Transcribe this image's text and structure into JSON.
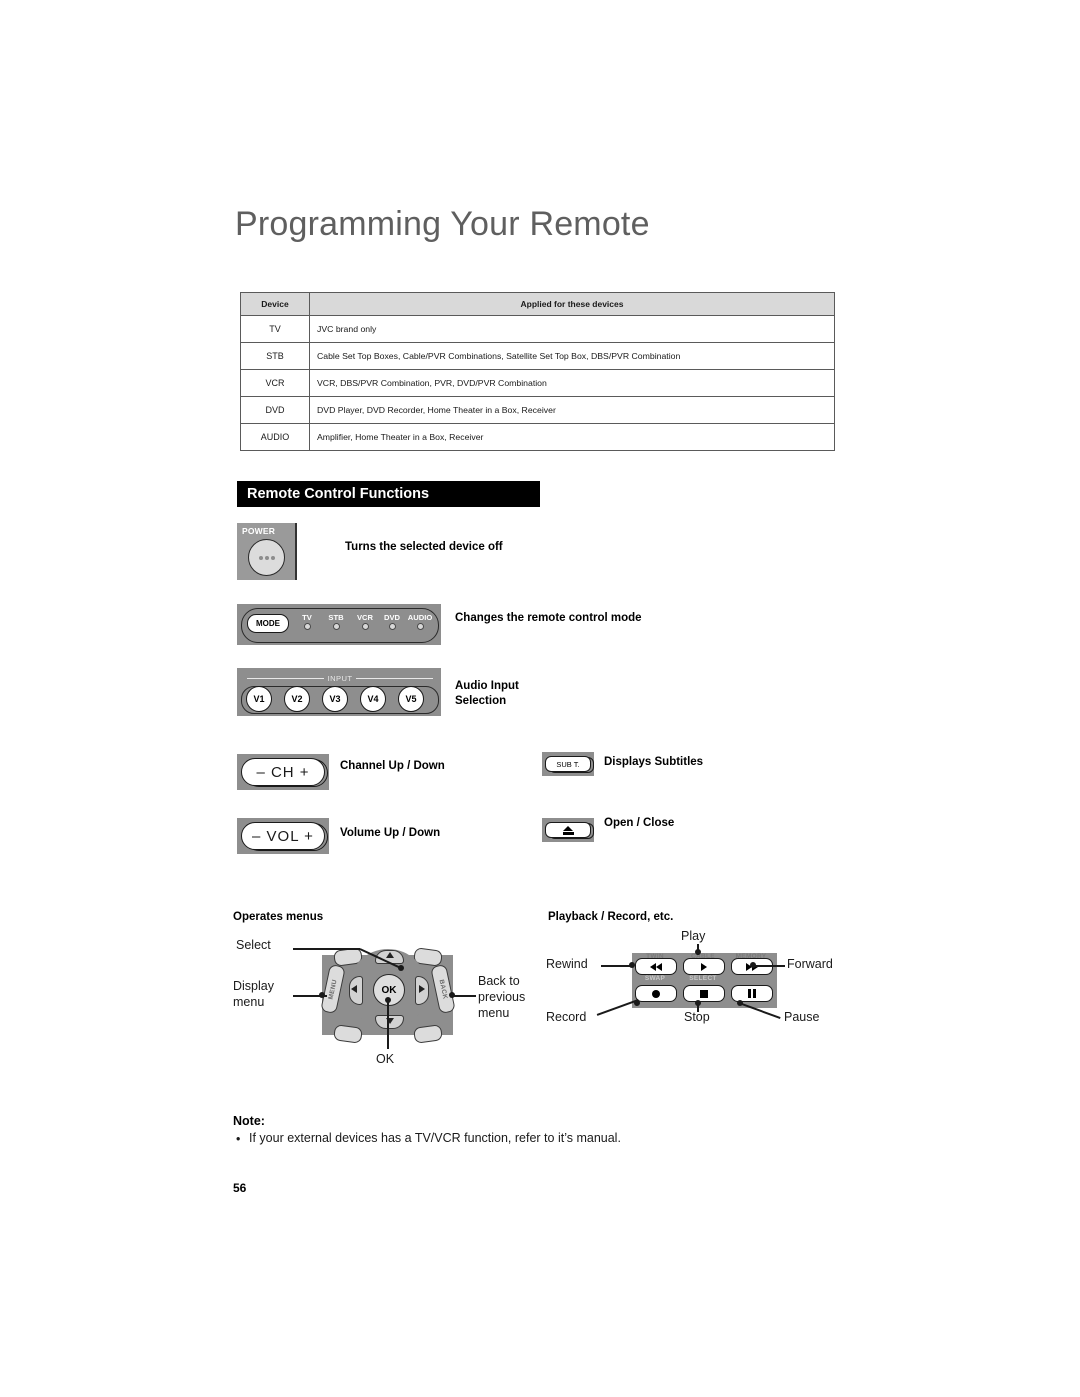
{
  "page": {
    "title": "Programming Your Remote",
    "number": "56"
  },
  "device_table": {
    "headers": [
      "Device",
      "Applied for these devices"
    ],
    "rows": [
      {
        "device": "TV",
        "applied": "JVC brand only"
      },
      {
        "device": "STB",
        "applied": "Cable Set Top Boxes, Cable/PVR Combinations, Satellite Set Top Box, DBS/PVR Combination"
      },
      {
        "device": "VCR",
        "applied": "VCR, DBS/PVR Combination, PVR, DVD/PVR Combination"
      },
      {
        "device": "DVD",
        "applied": "DVD Player, DVD Recorder, Home Theater in a Box, Receiver"
      },
      {
        "device": "AUDIO",
        "applied": "Amplifier, Home Theater in a Box, Receiver"
      }
    ]
  },
  "section": {
    "heading": "Remote Control Functions"
  },
  "functions": {
    "power": {
      "key_label": "POWER",
      "description": "Turns the selected device off"
    },
    "mode": {
      "key_label": "MODE",
      "indicators": [
        "TV",
        "STB",
        "VCR",
        "DVD",
        "AUDIO"
      ],
      "description": "Changes the remote control mode"
    },
    "input": {
      "rule_label": "INPUT",
      "keys": [
        "V1",
        "V2",
        "V3",
        "V4",
        "V5"
      ],
      "description": "Audio Input\nSelection"
    },
    "channel": {
      "key_label": "– CH +",
      "description": "Channel Up / Down"
    },
    "volume": {
      "key_label": "– VOL +",
      "description": "Volume Up / Down"
    },
    "subtitle": {
      "key_label": "SUB T.",
      "description": "Displays Subtitles"
    },
    "open_close": {
      "key_label": "eject-icon",
      "description": "Open / Close"
    }
  },
  "menu_section": {
    "heading": "Operates menus",
    "callouts": {
      "select": "Select",
      "display_menu": "Display\nmenu",
      "back_to_previous": "Back to\nprevious\nmenu",
      "ok": "OK"
    },
    "keys": {
      "ok": "OK",
      "menu": "MENU",
      "back": "BACK"
    }
  },
  "playback_section": {
    "heading": "Playback / Record, etc.",
    "callouts": {
      "play": "Play",
      "rewind": "Rewind",
      "forward": "Forward",
      "record": "Record",
      "stop": "Stop",
      "pause": "Pause"
    },
    "secondary_labels": {
      "swap": "SWAP",
      "select": "SELECT"
    }
  },
  "note": {
    "title": "Note:",
    "bullet": "•",
    "text": "If your external devices has a TV/VCR function, refer to it’s manual."
  }
}
